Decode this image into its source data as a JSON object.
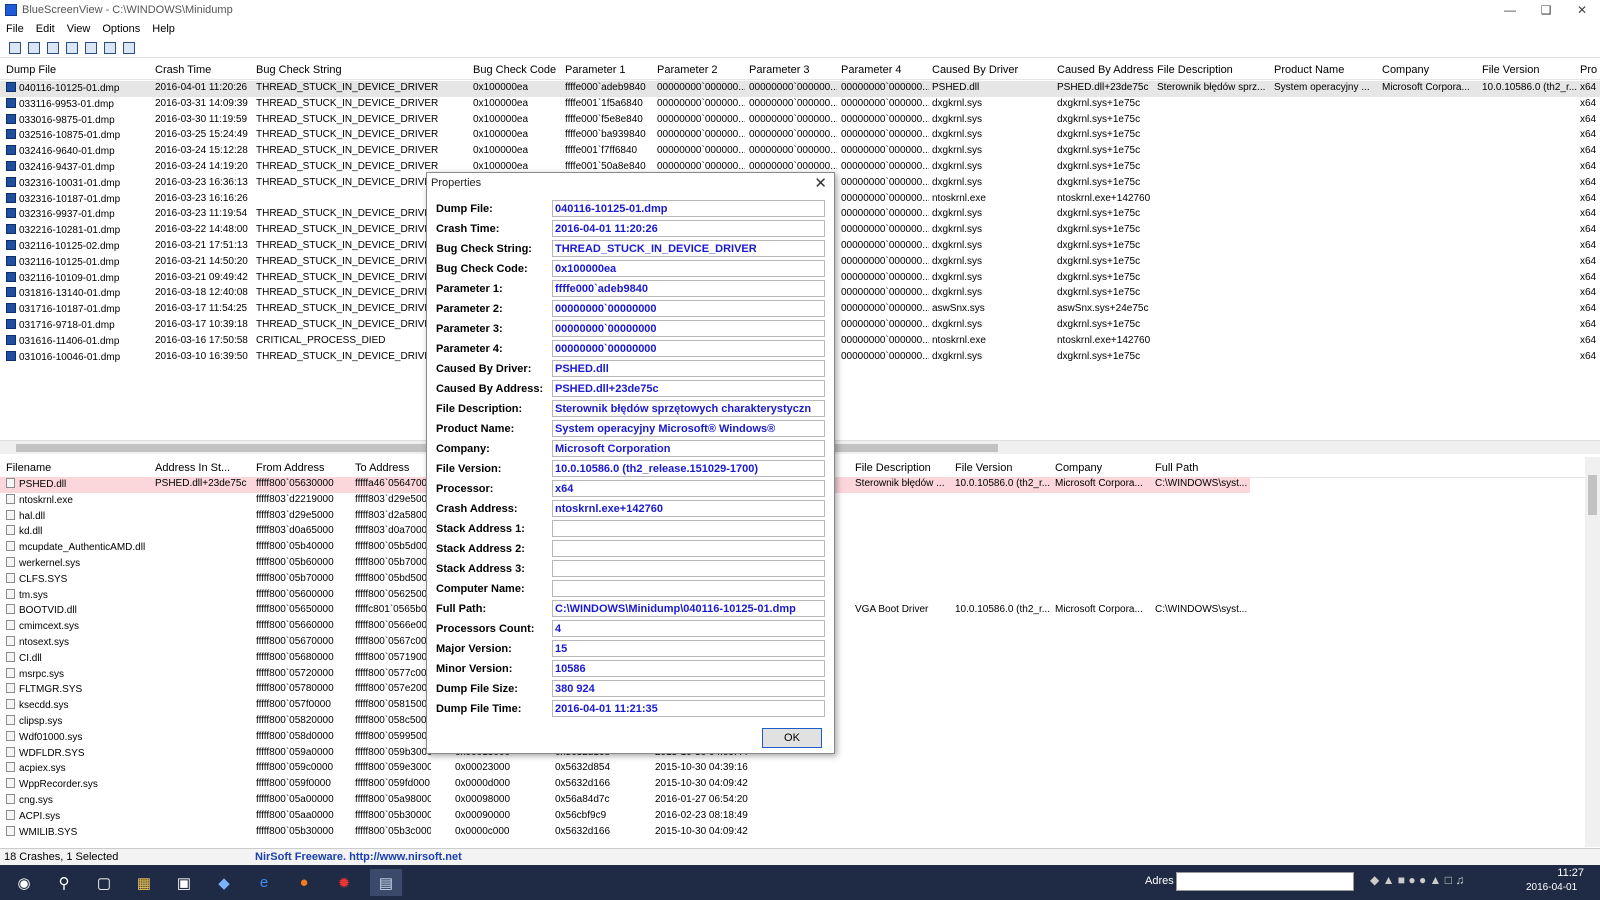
{
  "window": {
    "title": "BlueScreenView  -  C:\\WINDOWS\\Minidump"
  },
  "menu": [
    "File",
    "Edit",
    "View",
    "Options",
    "Help"
  ],
  "top_columns": [
    "Dump File",
    "Crash Time",
    "Bug Check String",
    "Bug Check Code",
    "Parameter 1",
    "Parameter 2",
    "Parameter 3",
    "Parameter 4",
    "Caused By Driver",
    "Caused By Address",
    "File Description",
    "Product Name",
    "Company",
    "File Version",
    "Pro"
  ],
  "dumps": [
    {
      "file": "040116-10125-01.dmp",
      "time": "2016-04-01 11:20:26",
      "bug": "THREAD_STUCK_IN_DEVICE_DRIVER",
      "code": "0x100000ea",
      "p1": "ffffe000`adeb9840",
      "p2": "00000000`000000...",
      "p3": "00000000`000000...",
      "p4": "00000000`000000...",
      "driver": "PSHED.dll",
      "addr": "PSHED.dll+23de75c",
      "desc": "Sterownik błędów sprz...",
      "product": "System operacyjny ...",
      "company": "Microsoft Corpora...",
      "version": "10.0.10586.0 (th2_r...",
      "proc": "x64"
    },
    {
      "file": "033116-9953-01.dmp",
      "time": "2016-03-31 14:09:39",
      "bug": "THREAD_STUCK_IN_DEVICE_DRIVER",
      "code": "0x100000ea",
      "p1": "ffffe001`1f5a6840",
      "p2": "00000000`000000...",
      "p3": "00000000`000000...",
      "p4": "00000000`000000...",
      "driver": "dxgkrnl.sys",
      "addr": "dxgkrnl.sys+1e75c",
      "proc": "x64"
    },
    {
      "file": "033016-9875-01.dmp",
      "time": "2016-03-30 11:19:59",
      "bug": "THREAD_STUCK_IN_DEVICE_DRIVER",
      "code": "0x100000ea",
      "p1": "ffffe000`f5e8e840",
      "p2": "00000000`000000...",
      "p3": "00000000`000000...",
      "p4": "00000000`000000...",
      "driver": "dxgkrnl.sys",
      "addr": "dxgkrnl.sys+1e75c",
      "proc": "x64"
    },
    {
      "file": "032516-10875-01.dmp",
      "time": "2016-03-25 15:24:49",
      "bug": "THREAD_STUCK_IN_DEVICE_DRIVER",
      "code": "0x100000ea",
      "p1": "ffffe000`ba939840",
      "p2": "00000000`000000...",
      "p3": "00000000`000000...",
      "p4": "00000000`000000...",
      "driver": "dxgkrnl.sys",
      "addr": "dxgkrnl.sys+1e75c",
      "proc": "x64"
    },
    {
      "file": "032416-9640-01.dmp",
      "time": "2016-03-24 15:12:28",
      "bug": "THREAD_STUCK_IN_DEVICE_DRIVER",
      "code": "0x100000ea",
      "p1": "ffffe001`f7ff6840",
      "p2": "00000000`000000...",
      "p3": "00000000`000000...",
      "p4": "00000000`000000...",
      "driver": "dxgkrnl.sys",
      "addr": "dxgkrnl.sys+1e75c",
      "proc": "x64"
    },
    {
      "file": "032416-9437-01.dmp",
      "time": "2016-03-24 14:19:20",
      "bug": "THREAD_STUCK_IN_DEVICE_DRIVER",
      "code": "0x100000ea",
      "p1": "ffffe001`50a8e840",
      "p2": "00000000`000000...",
      "p3": "00000000`000000...",
      "p4": "00000000`000000...",
      "driver": "dxgkrnl.sys",
      "addr": "dxgkrnl.sys+1e75c",
      "proc": "x64"
    },
    {
      "file": "032316-10031-01.dmp",
      "time": "2016-03-23 16:36:13",
      "bug": "THREAD_STUCK_IN_DEVICE_DRIVER",
      "code": "",
      "p1": "",
      "p2": "",
      "p3": "",
      "p4": "00000000`000000...",
      "driver": "dxgkrnl.sys",
      "addr": "dxgkrnl.sys+1e75c",
      "proc": "x64"
    },
    {
      "file": "032316-10187-01.dmp",
      "time": "2016-03-23 16:16:26",
      "bug": "",
      "code": "",
      "p1": "",
      "p2": "",
      "p3": "",
      "p4": "00000000`000000...",
      "driver": "ntoskrnl.exe",
      "addr": "ntoskrnl.exe+142760",
      "proc": "x64"
    },
    {
      "file": "032316-9937-01.dmp",
      "time": "2016-03-23 11:19:54",
      "bug": "THREAD_STUCK_IN_DEVICE_DRIVER",
      "code": "",
      "p1": "",
      "p2": "",
      "p3": "",
      "p4": "00000000`000000...",
      "driver": "dxgkrnl.sys",
      "addr": "dxgkrnl.sys+1e75c",
      "proc": "x64"
    },
    {
      "file": "032216-10281-01.dmp",
      "time": "2016-03-22 14:48:00",
      "bug": "THREAD_STUCK_IN_DEVICE_DRIVER",
      "code": "",
      "p1": "",
      "p2": "",
      "p3": "",
      "p4": "00000000`000000...",
      "driver": "dxgkrnl.sys",
      "addr": "dxgkrnl.sys+1e75c",
      "proc": "x64"
    },
    {
      "file": "032116-10125-02.dmp",
      "time": "2016-03-21 17:51:13",
      "bug": "THREAD_STUCK_IN_DEVICE_DRIVER",
      "code": "",
      "p1": "",
      "p2": "",
      "p3": "",
      "p4": "00000000`000000...",
      "driver": "dxgkrnl.sys",
      "addr": "dxgkrnl.sys+1e75c",
      "proc": "x64"
    },
    {
      "file": "032116-10125-01.dmp",
      "time": "2016-03-21 14:50:20",
      "bug": "THREAD_STUCK_IN_DEVICE_DRIVER",
      "code": "",
      "p1": "",
      "p2": "",
      "p3": "",
      "p4": "00000000`000000...",
      "driver": "dxgkrnl.sys",
      "addr": "dxgkrnl.sys+1e75c",
      "proc": "x64"
    },
    {
      "file": "032116-10109-01.dmp",
      "time": "2016-03-21 09:49:42",
      "bug": "THREAD_STUCK_IN_DEVICE_DRIVER",
      "code": "",
      "p1": "",
      "p2": "",
      "p3": "",
      "p4": "00000000`000000...",
      "driver": "dxgkrnl.sys",
      "addr": "dxgkrnl.sys+1e75c",
      "proc": "x64"
    },
    {
      "file": "031816-13140-01.dmp",
      "time": "2016-03-18 12:40:08",
      "bug": "THREAD_STUCK_IN_DEVICE_DRIVER",
      "code": "",
      "p1": "",
      "p2": "",
      "p3": "",
      "p4": "00000000`000000...",
      "driver": "dxgkrnl.sys",
      "addr": "dxgkrnl.sys+1e75c",
      "proc": "x64"
    },
    {
      "file": "031716-10187-01.dmp",
      "time": "2016-03-17 11:54:25",
      "bug": "THREAD_STUCK_IN_DEVICE_DRIVER",
      "code": "",
      "p1": "",
      "p2": "",
      "p3": "",
      "p4": "00000000`000000...",
      "driver": "aswSnx.sys",
      "addr": "aswSnx.sys+24e75c",
      "proc": "x64"
    },
    {
      "file": "031716-9718-01.dmp",
      "time": "2016-03-17 10:39:18",
      "bug": "THREAD_STUCK_IN_DEVICE_DRIVER",
      "code": "",
      "p1": "",
      "p2": "",
      "p3": "",
      "p4": "00000000`000000...",
      "driver": "dxgkrnl.sys",
      "addr": "dxgkrnl.sys+1e75c",
      "proc": "x64"
    },
    {
      "file": "031616-11406-01.dmp",
      "time": "2016-03-16 17:50:58",
      "bug": "CRITICAL_PROCESS_DIED",
      "code": "",
      "p1": "",
      "p2": "",
      "p3": "",
      "p4": "00000000`000000...",
      "driver": "ntoskrnl.exe",
      "addr": "ntoskrnl.exe+142760",
      "proc": "x64"
    },
    {
      "file": "031016-10046-01.dmp",
      "time": "2016-03-10 16:39:50",
      "bug": "THREAD_STUCK_IN_DEVICE_DRIVER",
      "code": "",
      "p1": "",
      "p2": "",
      "p3": "",
      "p4": "00000000`000000...",
      "driver": "dxgkrnl.sys",
      "addr": "dxgkrnl.sys+1e75c",
      "proc": "x64"
    }
  ],
  "bottom_columns": [
    "Filename",
    "Address In St...",
    "From Address",
    "To Address",
    "File Description",
    "File Version",
    "Company",
    "Full Path"
  ],
  "drivers": [
    {
      "name": "PSHED.dll",
      "addrst": "PSHED.dll+23de75c",
      "from": "fffff800`05630000",
      "to": "fffffa46`05647000",
      "desc": "Sterownik błędów ...",
      "ver": "10.0.10586.0 (th2_r...",
      "company": "Microsoft Corpora...",
      "path": "C:\\WINDOWS\\syst..."
    },
    {
      "name": "ntoskrnl.exe",
      "from": "fffff803`d2219000",
      "to": "fffff803`d29e5000"
    },
    {
      "name": "hal.dll",
      "from": "fffff803`d29e5000",
      "to": "fffff803`d2a58000"
    },
    {
      "name": "kd.dll",
      "from": "fffff803`d0a65000",
      "to": "fffff803`d0a70000"
    },
    {
      "name": "mcupdate_AuthenticAMD.dll",
      "from": "fffff800`05b40000",
      "to": "fffff800`05b5d000"
    },
    {
      "name": "werkernel.sys",
      "from": "fffff800`05b60000",
      "to": "fffff800`05b70000"
    },
    {
      "name": "CLFS.SYS",
      "from": "fffff800`05b70000",
      "to": "fffff800`05bd5000"
    },
    {
      "name": "tm.sys",
      "from": "fffff800`05600000",
      "to": "fffff800`05625000"
    },
    {
      "name": "BOOTVID.dll",
      "from": "fffff800`05650000",
      "to": "fffffc801`0565b000",
      "desc": "VGA Boot Driver",
      "ver": "10.0.10586.0 (th2_r...",
      "company": "Microsoft Corpora...",
      "path": "C:\\WINDOWS\\syst..."
    },
    {
      "name": "cmimcext.sys",
      "from": "fffff800`05660000",
      "to": "fffff800`0566e000"
    },
    {
      "name": "ntosext.sys",
      "from": "fffff800`05670000",
      "to": "fffff800`0567c000"
    },
    {
      "name": "CI.dll",
      "from": "fffff800`05680000",
      "to": "fffff800`05719000"
    },
    {
      "name": "msrpc.sys",
      "from": "fffff800`05720000",
      "to": "fffff800`0577c000"
    },
    {
      "name": "FLTMGR.SYS",
      "from": "fffff800`05780000",
      "to": "fffff800`057e2000"
    },
    {
      "name": "ksecdd.sys",
      "from": "fffff800`057f0000",
      "to": "fffff800`05815000"
    },
    {
      "name": "clipsp.sys",
      "from": "fffff800`05820000",
      "to": "fffff800`058c5000"
    },
    {
      "name": "Wdf01000.sys",
      "from": "fffff800`058d0000",
      "to": "fffff800`05995000"
    },
    {
      "name": "WDFLDR.SYS",
      "from": "fffff800`059a0000",
      "to": "fffff800`059b3000",
      "size": "0x00013000",
      "stamp": "0x5632d168",
      "date": "2015-10-30 04:09:44"
    },
    {
      "name": "acpiex.sys",
      "from": "fffff800`059c0000",
      "to": "fffff800`059e3000",
      "size": "0x00023000",
      "stamp": "0x5632d854",
      "date": "2015-10-30 04:39:16"
    },
    {
      "name": "WppRecorder.sys",
      "from": "fffff800`059f0000",
      "to": "fffff800`059fd000",
      "size": "0x0000d000",
      "stamp": "0x5632d166",
      "date": "2015-10-30 04:09:42"
    },
    {
      "name": "cng.sys",
      "from": "fffff800`05a00000",
      "to": "fffff800`05a98000",
      "size": "0x00098000",
      "stamp": "0x56a84d7c",
      "date": "2016-01-27 06:54:20"
    },
    {
      "name": "ACPI.sys",
      "from": "fffff800`05aa0000",
      "to": "fffff800`05b30000",
      "size": "0x00090000",
      "stamp": "0x56cbf9c9",
      "date": "2016-02-23 08:18:49"
    },
    {
      "name": "WMILIB.SYS",
      "from": "fffff800`05b30000",
      "to": "fffff800`05b3c000",
      "size": "0x0000c000",
      "stamp": "0x5632d166",
      "date": "2015-10-30 04:09:42"
    }
  ],
  "dialog": {
    "title": "Properties",
    "ok": "OK",
    "fields": [
      {
        "label": "Dump File:",
        "value": "040116-10125-01.dmp"
      },
      {
        "label": "Crash Time:",
        "value": "2016-04-01 11:20:26"
      },
      {
        "label": "Bug Check String:",
        "value": "THREAD_STUCK_IN_DEVICE_DRIVER"
      },
      {
        "label": "Bug Check Code:",
        "value": "0x100000ea"
      },
      {
        "label": "Parameter 1:",
        "value": "ffffe000`adeb9840"
      },
      {
        "label": "Parameter 2:",
        "value": "00000000`00000000"
      },
      {
        "label": "Parameter 3:",
        "value": "00000000`00000000"
      },
      {
        "label": "Parameter 4:",
        "value": "00000000`00000000"
      },
      {
        "label": "Caused By Driver:",
        "value": "PSHED.dll"
      },
      {
        "label": "Caused By Address:",
        "value": "PSHED.dll+23de75c"
      },
      {
        "label": "File Description:",
        "value": "Sterownik błędów sprzętowych charakterystyczn"
      },
      {
        "label": "Product Name:",
        "value": "System operacyjny Microsoft® Windows®"
      },
      {
        "label": "Company:",
        "value": "Microsoft Corporation"
      },
      {
        "label": "File Version:",
        "value": "10.0.10586.0 (th2_release.151029-1700)"
      },
      {
        "label": "Processor:",
        "value": "x64"
      },
      {
        "label": "Crash Address:",
        "value": "ntoskrnl.exe+142760"
      },
      {
        "label": "Stack Address 1:",
        "value": ""
      },
      {
        "label": "Stack Address 2:",
        "value": ""
      },
      {
        "label": "Stack Address 3:",
        "value": ""
      },
      {
        "label": "Computer Name:",
        "value": ""
      },
      {
        "label": "Full Path:",
        "value": "C:\\WINDOWS\\Minidump\\040116-10125-01.dmp"
      },
      {
        "label": "Processors Count:",
        "value": "4"
      },
      {
        "label": "Major Version:",
        "value": "15"
      },
      {
        "label": "Minor Version:",
        "value": "10586"
      },
      {
        "label": "Dump File Size:",
        "value": "380 924"
      },
      {
        "label": "Dump File Time:",
        "value": "2016-04-01 11:21:35"
      }
    ]
  },
  "status": {
    "left": "18 Crashes, 1 Selected",
    "right": "NirSoft Freeware.  http://www.nirsoft.net"
  },
  "taskbar": {
    "address_label": "Adres",
    "time": "11:27",
    "date": "2016-04-01"
  }
}
